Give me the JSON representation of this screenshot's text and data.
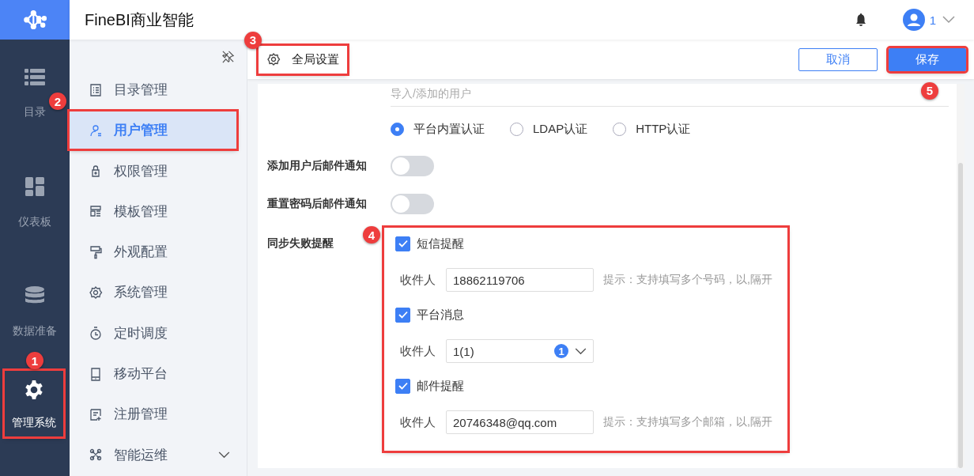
{
  "app": {
    "title": "FineBI商业智能",
    "user_name": "1"
  },
  "rail": [
    {
      "label": "目录",
      "selected": false,
      "highlighted": false
    },
    {
      "label": "仪表板",
      "selected": false,
      "highlighted": false
    },
    {
      "label": "数据准备",
      "selected": false,
      "highlighted": false
    },
    {
      "label": "管理系统",
      "selected": true,
      "highlighted": true,
      "callout": "1"
    }
  ],
  "nav": [
    {
      "label": "目录管理",
      "selected": false,
      "highlighted": false,
      "kind": "link"
    },
    {
      "label": "用户管理",
      "selected": true,
      "highlighted": true,
      "kind": "link",
      "callout": "2"
    },
    {
      "label": "权限管理",
      "selected": false,
      "highlighted": false,
      "kind": "link"
    },
    {
      "label": "模板管理",
      "selected": false,
      "highlighted": false,
      "kind": "link"
    },
    {
      "label": "外观配置",
      "selected": false,
      "highlighted": false,
      "kind": "link"
    },
    {
      "label": "系统管理",
      "selected": false,
      "highlighted": false,
      "kind": "link"
    },
    {
      "label": "定时调度",
      "selected": false,
      "highlighted": false,
      "kind": "link"
    },
    {
      "label": "移动平台",
      "selected": false,
      "highlighted": false,
      "kind": "link"
    },
    {
      "label": "注册管理",
      "selected": false,
      "highlighted": false,
      "kind": "link"
    },
    {
      "label": "智能运维",
      "selected": false,
      "highlighted": false,
      "kind": "group"
    }
  ],
  "header": {
    "title": "全局设置",
    "highlighted": true,
    "callout": "3",
    "buttons": [
      {
        "label": "取消",
        "kind": "secondary",
        "highlighted": false
      },
      {
        "label": "保存",
        "kind": "primary",
        "highlighted": true,
        "callout": "5"
      }
    ]
  },
  "form": {
    "users_note": "导入/添加的用户",
    "auth_options": [
      {
        "label": "平台内置认证",
        "selected": true
      },
      {
        "label": "LDAP认证",
        "selected": false
      },
      {
        "label": "HTTP认证",
        "selected": false
      }
    ],
    "toggles": [
      {
        "label": "添加用户后邮件通知",
        "on": false
      },
      {
        "label": "重置密码后邮件通知",
        "on": false
      }
    ],
    "sync_failure": {
      "label": "同步失败提醒",
      "highlighted": true,
      "callout": "4",
      "channels": [
        {
          "label": "短信提醒",
          "checked": true,
          "kind": "text",
          "recipient_label": "收件人",
          "value": "18862119706",
          "hint": "提示：支持填写多个号码，以,隔开"
        },
        {
          "label": "平台消息",
          "checked": true,
          "kind": "select",
          "recipient_label": "收件人",
          "value": "1(1)",
          "count": "1"
        },
        {
          "label": "邮件提醒",
          "checked": true,
          "kind": "text",
          "recipient_label": "收件人",
          "value": "20746348@qq.com",
          "hint": "提示：支持填写多个邮箱，以,隔开"
        }
      ]
    }
  }
}
